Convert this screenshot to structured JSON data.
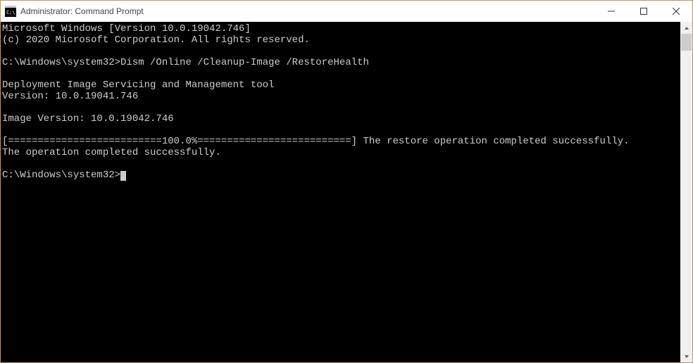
{
  "window": {
    "title": "Administrator: Command Prompt"
  },
  "terminal": {
    "lines": [
      "Microsoft Windows [Version 10.0.19042.746]",
      "(c) 2020 Microsoft Corporation. All rights reserved.",
      "",
      "C:\\Windows\\system32>Dism /Online /Cleanup-Image /RestoreHealth",
      "",
      "Deployment Image Servicing and Management tool",
      "Version: 10.0.19041.746",
      "",
      "Image Version: 10.0.19042.746",
      "",
      "[==========================100.0%==========================] The restore operation completed successfully.",
      "The operation completed successfully.",
      ""
    ],
    "prompt": "C:\\Windows\\system32>"
  }
}
